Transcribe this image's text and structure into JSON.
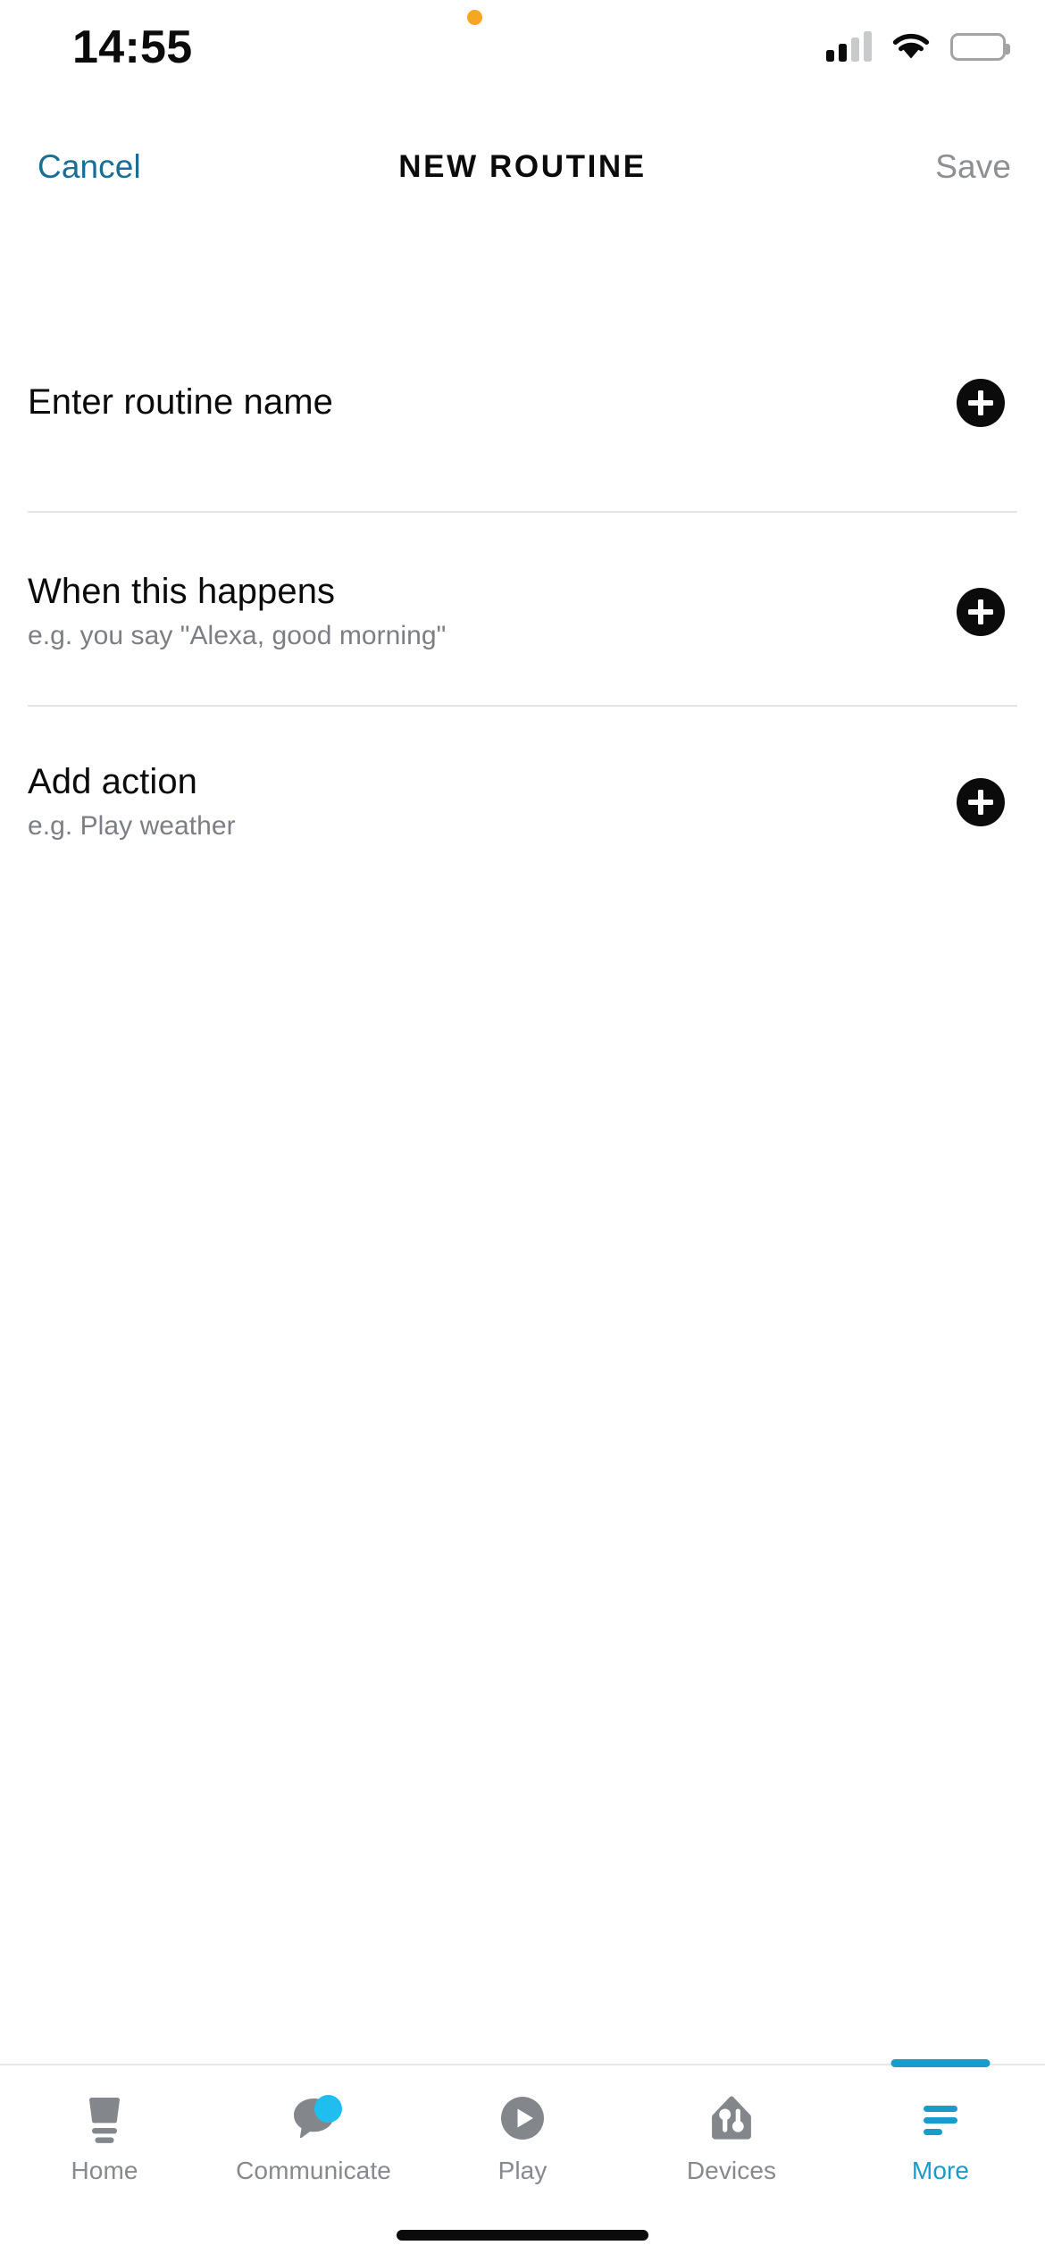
{
  "status_bar": {
    "time": "14:55",
    "privacy_indicator": "orange-privacy-dot",
    "signal_icon": "cellular-signal-icon",
    "signal_bars_filled": 2,
    "signal_bars_total": 4,
    "wifi_icon": "wifi-icon",
    "battery_icon": "battery-icon",
    "battery_level_percent": 88
  },
  "navbar": {
    "cancel_label": "Cancel",
    "title": "NEW ROUTINE",
    "save_label": "Save",
    "cancel_color": "#1A6E96",
    "save_color": "#8D8F93",
    "title_color": "#0B0B0C"
  },
  "main": {
    "rows": [
      {
        "title": "Enter routine name",
        "subtitle": "",
        "add_icon": "plus-circle-icon"
      },
      {
        "title": "When this happens",
        "subtitle": "e.g. you say \"Alexa, good morning\"",
        "add_icon": "plus-circle-icon"
      },
      {
        "title": "Add action",
        "subtitle": "e.g. Play weather",
        "add_icon": "plus-circle-icon"
      }
    ]
  },
  "tabbar": {
    "active_index": 4,
    "active_color": "#1A9BC9",
    "inactive_color": "#87898E",
    "badge_color": "#1FBEEE",
    "items": [
      {
        "label": "Home",
        "icon": "echo-speaker-icon",
        "badge": false
      },
      {
        "label": "Communicate",
        "icon": "speech-bubble-icon",
        "badge": true
      },
      {
        "label": "Play",
        "icon": "play-circle-icon",
        "badge": false
      },
      {
        "label": "Devices",
        "icon": "smart-home-icon",
        "badge": false
      },
      {
        "label": "More",
        "icon": "hamburger-menu-icon",
        "badge": false
      }
    ]
  },
  "home_indicator": {
    "name": "home-indicator"
  }
}
